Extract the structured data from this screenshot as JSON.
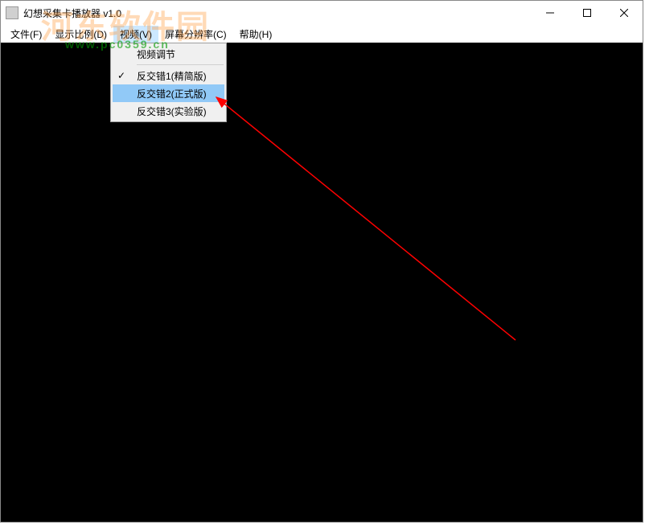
{
  "window": {
    "title": "幻想采集卡播放器 v1.0"
  },
  "menubar": {
    "items": [
      {
        "label": "文件(F)"
      },
      {
        "label": "显示比例(D)"
      },
      {
        "label": "视频(V)"
      },
      {
        "label": "屏幕分辨率(C)"
      },
      {
        "label": "帮助(H)"
      }
    ],
    "active_index": 2
  },
  "dropdown": {
    "header": "视频调节",
    "items": [
      {
        "label": "反交错1(精简版)",
        "checked": true,
        "highlight": false
      },
      {
        "label": "反交错2(正式版)",
        "checked": false,
        "highlight": true
      },
      {
        "label": "反交错3(实验版)",
        "checked": false,
        "highlight": false
      }
    ]
  },
  "watermark": {
    "line1": "河东软件园",
    "line2": "www.pc0359.cn"
  },
  "icons": {
    "minimize": "minimize",
    "maximize": "maximize",
    "close": "close",
    "check": "✓"
  }
}
